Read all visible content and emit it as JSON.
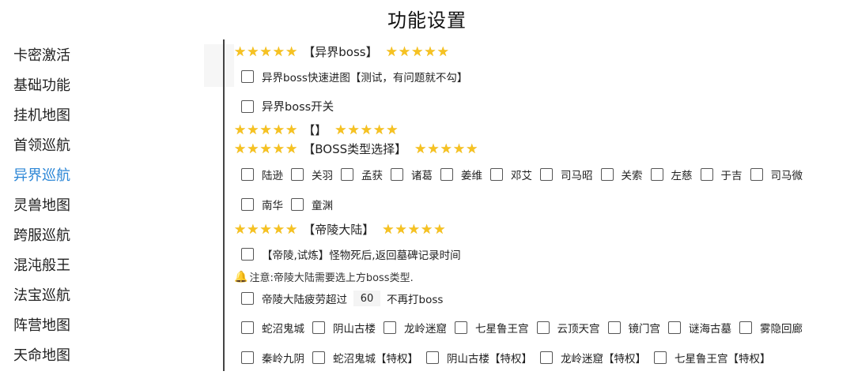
{
  "page": {
    "title": "功能设置"
  },
  "sidebar": {
    "items": [
      {
        "label": "卡密激活"
      },
      {
        "label": "基础功能"
      },
      {
        "label": "挂机地图"
      },
      {
        "label": "首领巡航"
      },
      {
        "label": "异界巡航",
        "active": true
      },
      {
        "label": "灵兽地图"
      },
      {
        "label": "跨服巡航"
      },
      {
        "label": "混沌般王"
      },
      {
        "label": "法宝巡航"
      },
      {
        "label": "阵营地图"
      },
      {
        "label": "天命地图"
      }
    ]
  },
  "icons": {
    "star": "star-icon",
    "bell": "bell-icon",
    "star_color": "#f6c222",
    "active_color": "#2b86d6"
  },
  "sections": {
    "yijie": {
      "label": "【异界boss】",
      "options": [
        {
          "label": "异界boss快速进图【测试，有问题就不勾】"
        },
        {
          "label": "异界boss开关"
        }
      ]
    },
    "empty": {
      "label": "【】"
    },
    "boss_type": {
      "label": "【BOSS类型选择】",
      "row1": [
        {
          "label": "陆逊"
        },
        {
          "label": "关羽"
        },
        {
          "label": "孟获"
        },
        {
          "label": "诸葛"
        },
        {
          "label": "姜维"
        },
        {
          "label": "邓艾"
        },
        {
          "label": "司马昭"
        },
        {
          "label": "关索"
        },
        {
          "label": "左慈"
        },
        {
          "label": "于吉"
        },
        {
          "label": "司马微"
        }
      ],
      "row2": [
        {
          "label": "南华"
        },
        {
          "label": "童渊"
        }
      ]
    },
    "diling": {
      "label": "【帝陵大陆】",
      "option1": {
        "label": "【帝陵,试炼】怪物死后,返回墓碑记录时间"
      },
      "note": "注意:帝陵大陆需要选上方boss类型.",
      "fatigue": {
        "prefix": "帝陵大陆疲劳超过",
        "value": "60",
        "suffix": "不再打boss"
      },
      "row_maps1": [
        {
          "label": "蛇沼鬼城"
        },
        {
          "label": "阴山古楼"
        },
        {
          "label": "龙岭迷窟"
        },
        {
          "label": "七星鲁王宫"
        },
        {
          "label": "云顶天宫"
        },
        {
          "label": "镜门宫"
        },
        {
          "label": "谜海古墓"
        },
        {
          "label": "雾隐回廊"
        }
      ],
      "row_maps2": [
        {
          "label": "秦岭九阴"
        },
        {
          "label": "蛇沼鬼城【特权】"
        },
        {
          "label": "阴山古楼【特权】"
        },
        {
          "label": "龙岭迷窟【特权】"
        },
        {
          "label": "七星鲁王宫【特权】"
        }
      ]
    }
  }
}
